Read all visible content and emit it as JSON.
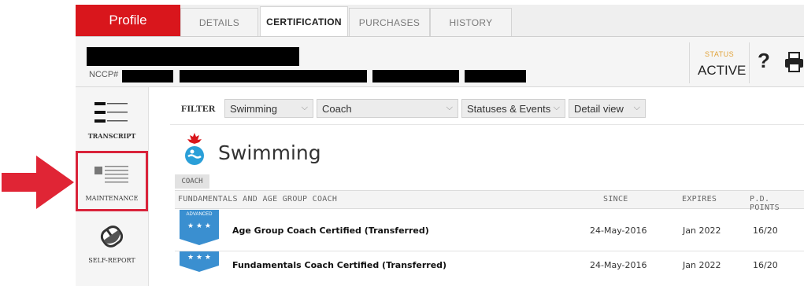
{
  "tabs": {
    "profile": "Profile",
    "items": [
      {
        "label": "DETAILS"
      },
      {
        "label": "CERTIFICATION"
      },
      {
        "label": "PURCHASES"
      },
      {
        "label": "HISTORY"
      }
    ],
    "active": "CERTIFICATION"
  },
  "header": {
    "nccp_label": "NCCP#",
    "status_label": "STATUS",
    "status_value": "ACTIVE",
    "help_icon": "?"
  },
  "leftnav": {
    "items": [
      {
        "label": "TRANSCRIPT",
        "icon": "transcript-icon"
      },
      {
        "label": "MAINTENANCE",
        "icon": "maintenance-icon"
      },
      {
        "label": "SELF-REPORT",
        "icon": "self-report-icon"
      }
    ]
  },
  "filter": {
    "label": "FILTER",
    "sport": "Swimming",
    "role": "Coach",
    "statuses": "Statuses & Events",
    "view": "Detail view"
  },
  "sport": {
    "title": "Swimming"
  },
  "table": {
    "context_tag": "COACH",
    "headers": {
      "name": "FUNDAMENTALS AND AGE GROUP COACH",
      "since": "SINCE",
      "expires": "EXPIRES",
      "pd_points": "P.D. POINTS"
    },
    "rows": [
      {
        "badge": "ADVANCED",
        "stars": "★ ★ ★",
        "title": "Age Group Coach Certified (Transferred)",
        "since": "24-May-2016",
        "expires": "Jan 2022",
        "points": "16/20"
      },
      {
        "badge": "",
        "stars": "★ ★ ★",
        "title": "Fundamentals Coach Certified (Transferred)",
        "since": "24-May-2016",
        "expires": "Jan 2022",
        "points": "16/20"
      }
    ]
  },
  "colors": {
    "brand_red": "#d9161c",
    "highlight_red": "#d9233a",
    "badge_blue": "#3a8fd0",
    "status_orange": "#e1a33a"
  }
}
